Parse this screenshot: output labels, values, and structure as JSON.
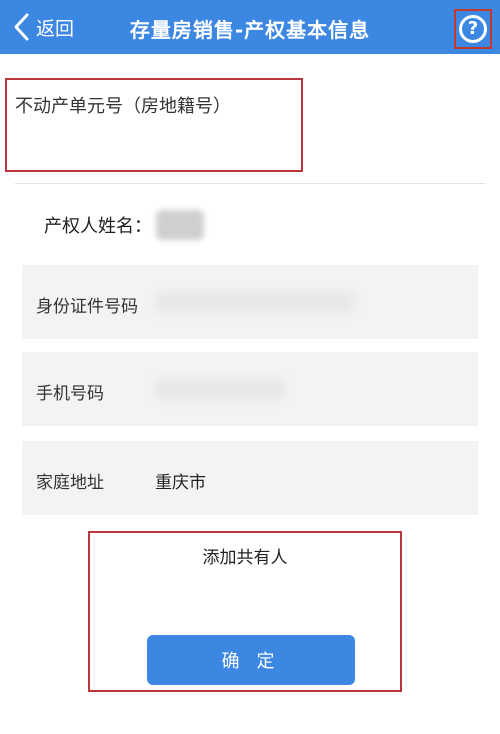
{
  "header": {
    "back_label": "返回",
    "title": "存量房销售-产权基本信息",
    "help_symbol": "?"
  },
  "property": {
    "unit_label": "不动产单元号（房地籍号）"
  },
  "owner": {
    "name_label": "产权人姓名："
  },
  "fields": [
    {
      "label": "身份证件号码",
      "value": ""
    },
    {
      "label": "手机号码",
      "value": ""
    },
    {
      "label": "家庭地址",
      "value": "重庆市"
    }
  ],
  "actions": {
    "add_coowner": "添加共有人",
    "confirm": "确 定"
  },
  "colors": {
    "header_bg": "#3b87e2",
    "highlight_border": "#b9373a",
    "field_bg": "#f3f3f3"
  }
}
